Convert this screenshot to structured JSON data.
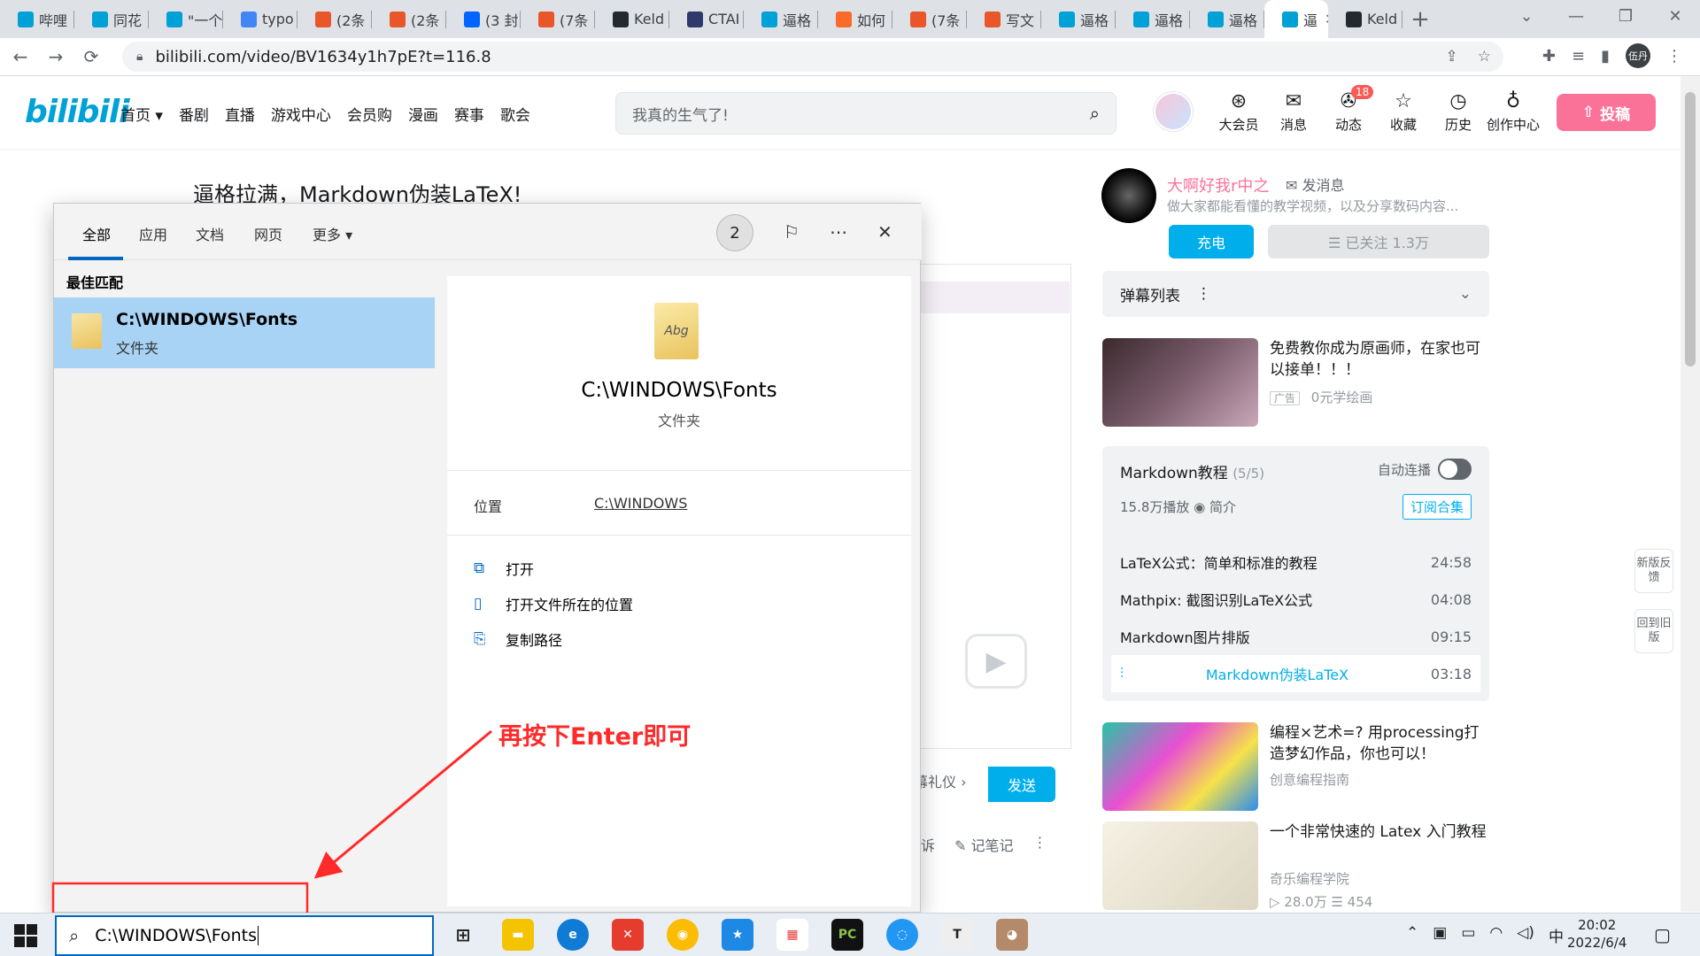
{
  "browser": {
    "tabs": [
      {
        "label": "哔哩",
        "icon": "bilibili-icon",
        "color": "#00a1d6"
      },
      {
        "label": "同花",
        "icon": "bilibili-icon",
        "color": "#00a1d6"
      },
      {
        "label": "\"一个",
        "icon": "bilibili-icon",
        "color": "#00a1d6"
      },
      {
        "label": "typo",
        "icon": "google-icon",
        "color": "#4285f4"
      },
      {
        "label": "(2条",
        "icon": "csdn-icon",
        "color": "#e8562a"
      },
      {
        "label": "(2条",
        "icon": "csdn-icon",
        "color": "#e8562a"
      },
      {
        "label": "(3 封",
        "icon": "zhihu-icon",
        "color": "#0066ff"
      },
      {
        "label": "(7条",
        "icon": "csdn-icon",
        "color": "#e8562a"
      },
      {
        "label": "Keld",
        "icon": "github-icon",
        "color": "#24292f"
      },
      {
        "label": "CTAI",
        "icon": "ctai-icon",
        "color": "#2d3a6b"
      },
      {
        "label": "逼格",
        "icon": "bilibili-icon",
        "color": "#00a1d6"
      },
      {
        "label": "如何",
        "icon": "sogou-icon",
        "color": "#fa6a2a"
      },
      {
        "label": "(7条",
        "icon": "csdn-icon",
        "color": "#e8562a"
      },
      {
        "label": "写文",
        "icon": "csdn-icon",
        "color": "#e8562a"
      },
      {
        "label": "逼格",
        "icon": "bilibili-icon",
        "color": "#00a1d6"
      },
      {
        "label": "逼格",
        "icon": "bilibili-icon",
        "color": "#00a1d6"
      },
      {
        "label": "逼格",
        "icon": "bilibili-icon",
        "color": "#00a1d6"
      },
      {
        "label": "逼",
        "icon": "bilibili-icon",
        "color": "#00a1d6",
        "active": true
      },
      {
        "label": "Keld",
        "icon": "github-icon",
        "color": "#24292f"
      }
    ],
    "url": "bilibili.com/video/BV1634y1h7pE?t=116.8",
    "profile_label": "伍丹"
  },
  "bili": {
    "logo": "bilibili",
    "nav": [
      "首页 ▾",
      "番剧",
      "直播",
      "游戏中心",
      "会员购",
      "漫画",
      "赛事",
      "歌会"
    ],
    "search_placeholder": "我真的生气了!",
    "right_items": [
      {
        "label": "大会员",
        "icon": "vip-icon",
        "glyph": "⊛"
      },
      {
        "label": "消息",
        "icon": "message-icon",
        "glyph": "✉"
      },
      {
        "label": "动态",
        "icon": "dynamic-icon",
        "glyph": "✇",
        "badge": "18"
      },
      {
        "label": "收藏",
        "icon": "favorite-icon",
        "glyph": "☆"
      },
      {
        "label": "历史",
        "icon": "history-icon",
        "glyph": "◷"
      },
      {
        "label": "创作中心",
        "icon": "creator-icon",
        "glyph": "♁"
      }
    ],
    "upload_label": "投稿",
    "video_title": "逼格拉满，Markdown伪装LaTeX!",
    "danmaku_etiquette": "幕礼仪 ›",
    "send_label": "发送",
    "below_player": [
      "诉",
      "记笔记",
      "⋮"
    ],
    "up": {
      "name": "大啊好我r中之",
      "message_label": "发消息",
      "desc": "做大家都能看懂的教学视频，以及分享数码内容...",
      "charge_label": "充电",
      "follow_label": "☰ 已关注 1.3万"
    },
    "danmaku_list_label": "弹幕列表",
    "ad": {
      "title": "免费教你成为原画师，在家也可以接单！！！",
      "tag": "广告",
      "meta": "0元学绘画"
    },
    "collection": {
      "title": "Markdown教程",
      "count": "(5/5)",
      "autoplay_label": "自动连播",
      "stats": "15.8万播放  ◉ 简介",
      "subscribe_label": "订阅合集",
      "episodes": [
        {
          "title": "LaTeX公式：简单和标准的教程",
          "duration": "24:58"
        },
        {
          "title": "Mathpix: 截图识别LaTeX公式",
          "duration": "04:08"
        },
        {
          "title": "Markdown图片排版",
          "duration": "09:15"
        },
        {
          "title": "Markdown伪装LaTeX",
          "duration": "03:18",
          "current": true
        }
      ]
    },
    "recs": [
      {
        "title": "编程×艺术=? 用processing打造梦幻作品，你也可以！",
        "meta1": "创意编程指南",
        "meta2": ""
      },
      {
        "title": "一个非常快速的 Latex 入门教程",
        "meta1": "奇乐编程学院",
        "meta2": "▷ 28.0万  ☰ 454"
      }
    ],
    "side_buttons": [
      "新版反馈",
      "回到旧版"
    ]
  },
  "search_panel": {
    "tabs": [
      "全部",
      "应用",
      "文档",
      "网页",
      "更多 ▾"
    ],
    "badge": "2",
    "best_match_label": "最佳匹配",
    "result_name": "C:\\WINDOWS\\Fonts",
    "result_type": "文件夹",
    "location_label": "位置",
    "location_value": "C:\\WINDOWS",
    "actions": [
      {
        "label": "打开",
        "icon": "open-icon",
        "glyph": "⧉"
      },
      {
        "label": "打开文件所在的位置",
        "icon": "open-location-icon",
        "glyph": "▯"
      },
      {
        "label": "复制路径",
        "icon": "copy-path-icon",
        "glyph": "⎘"
      }
    ]
  },
  "annotation": "再按下Enter即可",
  "taskbar": {
    "search_value": "C:\\WINDOWS\\Fonts",
    "tray_ime": "中",
    "time": "20:02",
    "date": "2022/6/4"
  }
}
